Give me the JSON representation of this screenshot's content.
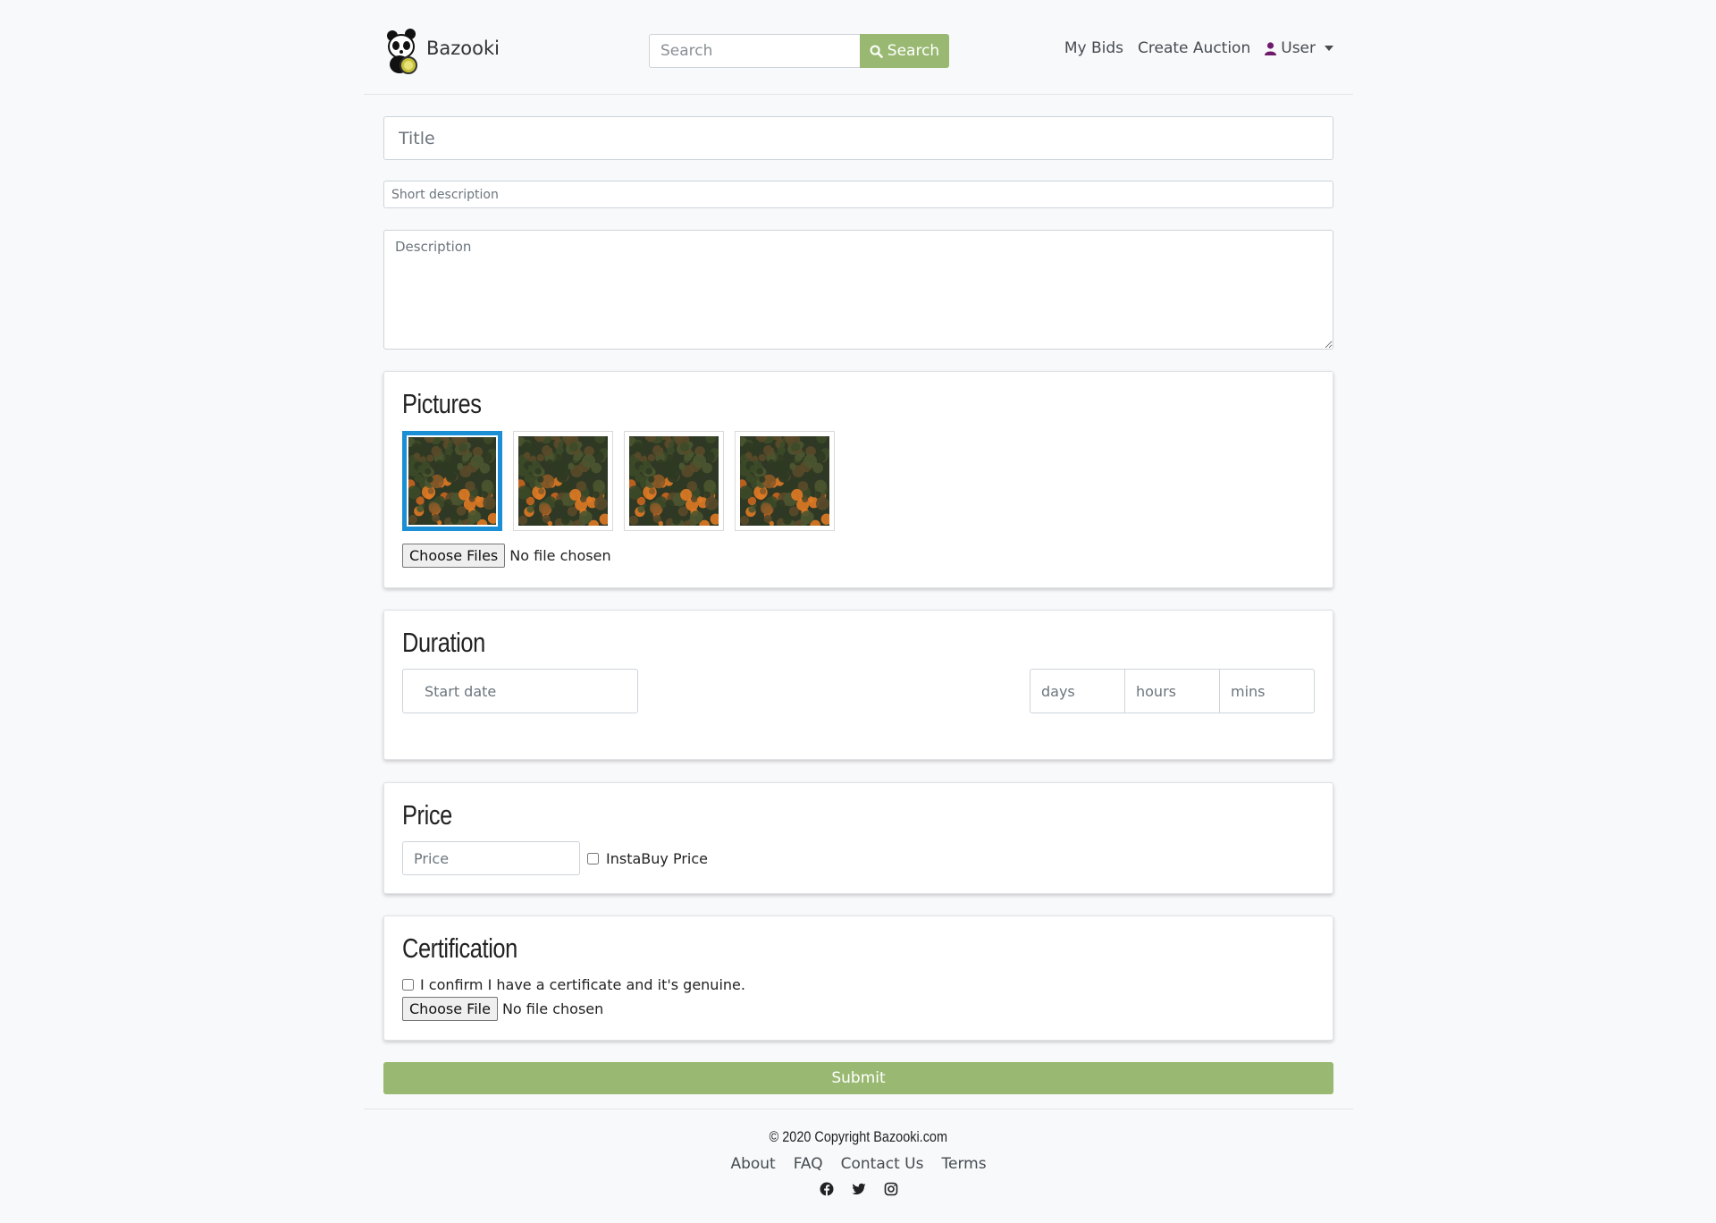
{
  "header": {
    "brand": "Bazooki",
    "search_placeholder": "Search",
    "search_button": "Search",
    "nav": {
      "my_bids": "My Bids",
      "create_auction": "Create Auction",
      "user": "User"
    }
  },
  "form": {
    "title_placeholder": "Title",
    "short_description_placeholder": "Short description",
    "description_placeholder": "Description",
    "pictures": {
      "heading": "Pictures",
      "thumbnail_count": 4,
      "selected_index": 0,
      "choose_files": "Choose Files",
      "no_file": "No file chosen"
    },
    "duration": {
      "heading": "Duration",
      "start_date_placeholder": "Start date",
      "days_placeholder": "days",
      "hours_placeholder": "hours",
      "mins_placeholder": "mins"
    },
    "price": {
      "heading": "Price",
      "price_placeholder": "Price",
      "instabuy_label": "InstaBuy Price",
      "instabuy_checked": false
    },
    "certification": {
      "heading": "Certification",
      "confirm_label": "I confirm I have a certificate and it's genuine.",
      "confirm_checked": false,
      "choose_file": "Choose File",
      "no_file": "No file chosen"
    },
    "submit": "Submit"
  },
  "footer": {
    "copyright": "© 2020 Copyright Bazooki.com",
    "links": [
      "About",
      "FAQ",
      "Contact Us",
      "Terms"
    ],
    "social_icons": [
      "facebook-icon",
      "twitter-icon",
      "instagram-icon"
    ]
  },
  "colors": {
    "accent": "#99b972",
    "selected_border": "#1a8fd6",
    "user_icon": "#6f1a6b"
  }
}
